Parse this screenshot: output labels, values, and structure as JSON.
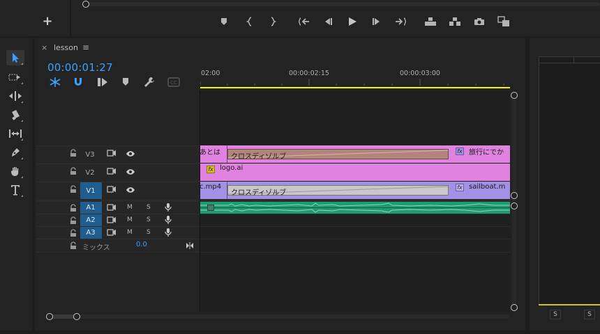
{
  "toolbar": {
    "add_label": "+",
    "controls": [
      "marker-icon",
      "mark-in-icon",
      "mark-out-icon",
      "go-to-in-icon",
      "step-back-icon",
      "play-icon",
      "step-forward-icon",
      "go-to-out-icon",
      "lift-icon",
      "extract-icon",
      "camera-icon",
      "compare-icon"
    ]
  },
  "tools": [
    "selection-tool-icon",
    "track-select-icon",
    "ripple-edit-icon",
    "razor-icon",
    "slip-icon",
    "pen-icon",
    "hand-icon",
    "type-icon"
  ],
  "sequence": {
    "close_label": "×",
    "name": "lesson",
    "menu_label": "≡",
    "timecode": "00:00:01:27",
    "timecode_color": "#3aa0ff"
  },
  "ruler": {
    "ticks": [
      "02:00",
      "00:00:02:15",
      "00:00:03:00"
    ]
  },
  "tracks": {
    "video": [
      {
        "name": "V3",
        "active": false
      },
      {
        "name": "V2",
        "active": false
      },
      {
        "name": "V1",
        "active": true
      }
    ],
    "audio": [
      {
        "name": "A1",
        "mute": "M",
        "solo": "S"
      },
      {
        "name": "A2",
        "mute": "M",
        "solo": "S"
      },
      {
        "name": "A3",
        "mute": "M",
        "solo": "S"
      }
    ],
    "mix": {
      "label": "ミックス",
      "value": "0.0"
    }
  },
  "clips": {
    "v3_left": "あとは",
    "v3_transition": "クロスディゾルブ",
    "v3_fx": "fx",
    "v3_right": "旅行にでか",
    "v2_fx": "fx",
    "v2_name": "logo.ai",
    "v1_left": "c.mp4",
    "v1_transition": "クロスディゾルブ",
    "v1_fx": "fx",
    "v1_right": "sailboat.m"
  },
  "right_panel": {
    "solo_labels": [
      "S",
      "S"
    ]
  },
  "colors": {
    "clip_pink": "#e083e0",
    "clip_violet": "#a391e6",
    "audio_green": "#1f9a73",
    "track_active": "#1f5d8f",
    "playhead": "#f5f500"
  }
}
